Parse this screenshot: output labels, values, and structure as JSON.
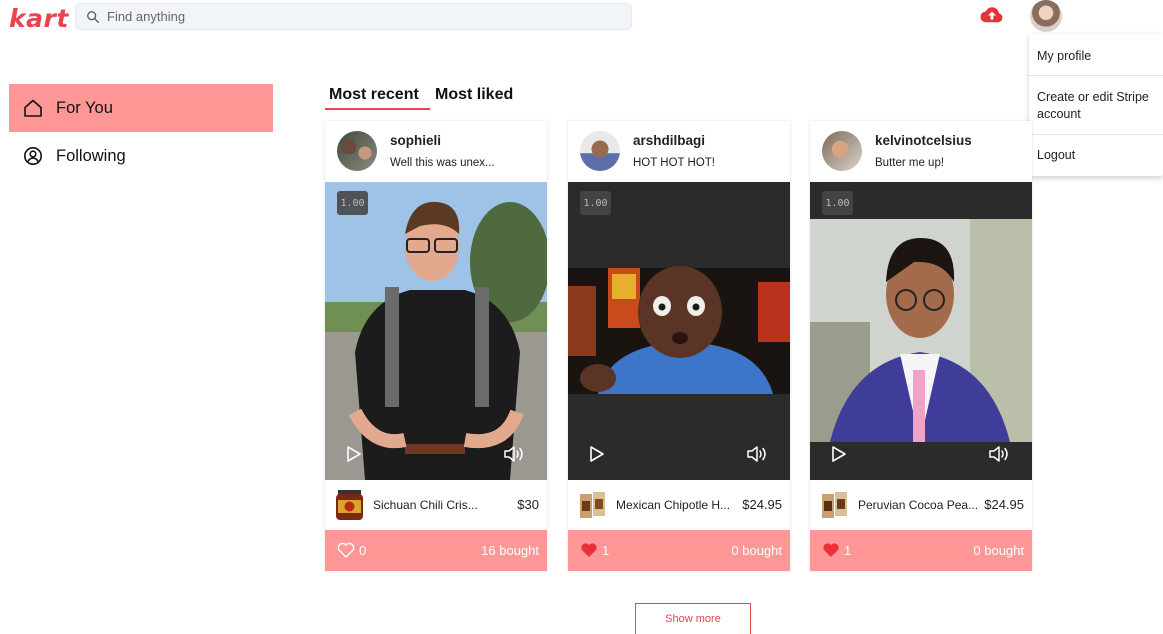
{
  "header": {
    "logo": "kart",
    "search_placeholder": "Find anything"
  },
  "dropdown": {
    "items": [
      "My profile",
      "Create or edit Stripe account",
      "Logout"
    ]
  },
  "sidebar": {
    "items": [
      {
        "label": "For You",
        "active": true,
        "icon": "home-icon"
      },
      {
        "label": "Following",
        "active": false,
        "icon": "user-circle-icon"
      }
    ]
  },
  "tabs": [
    "Most recent",
    "Most liked"
  ],
  "cards": [
    {
      "username": "sophieli",
      "caption": "Well this was unex...",
      "speed": "1.00",
      "product_name": "Sichuan Chili Cris...",
      "price": "$30",
      "likes": "0",
      "liked": false,
      "bought": "16 bought"
    },
    {
      "username": "arshdilbagi",
      "caption": "HOT HOT HOT!",
      "speed": "1.00",
      "product_name": "Mexican Chipotle H...",
      "price": "$24.95",
      "likes": "1",
      "liked": true,
      "bought": "0 bought"
    },
    {
      "username": "kelvinotcelsius",
      "caption": "Butter me up!",
      "speed": "1.00",
      "product_name": "Peruvian Cocoa Pea...",
      "price": "$24.95",
      "likes": "1",
      "liked": true,
      "bought": "0 bought"
    }
  ],
  "show_more": "Show more",
  "colors": {
    "brand": "#e8454f",
    "accent_pink": "#ff9797",
    "heart_filled": "#e8313b"
  }
}
